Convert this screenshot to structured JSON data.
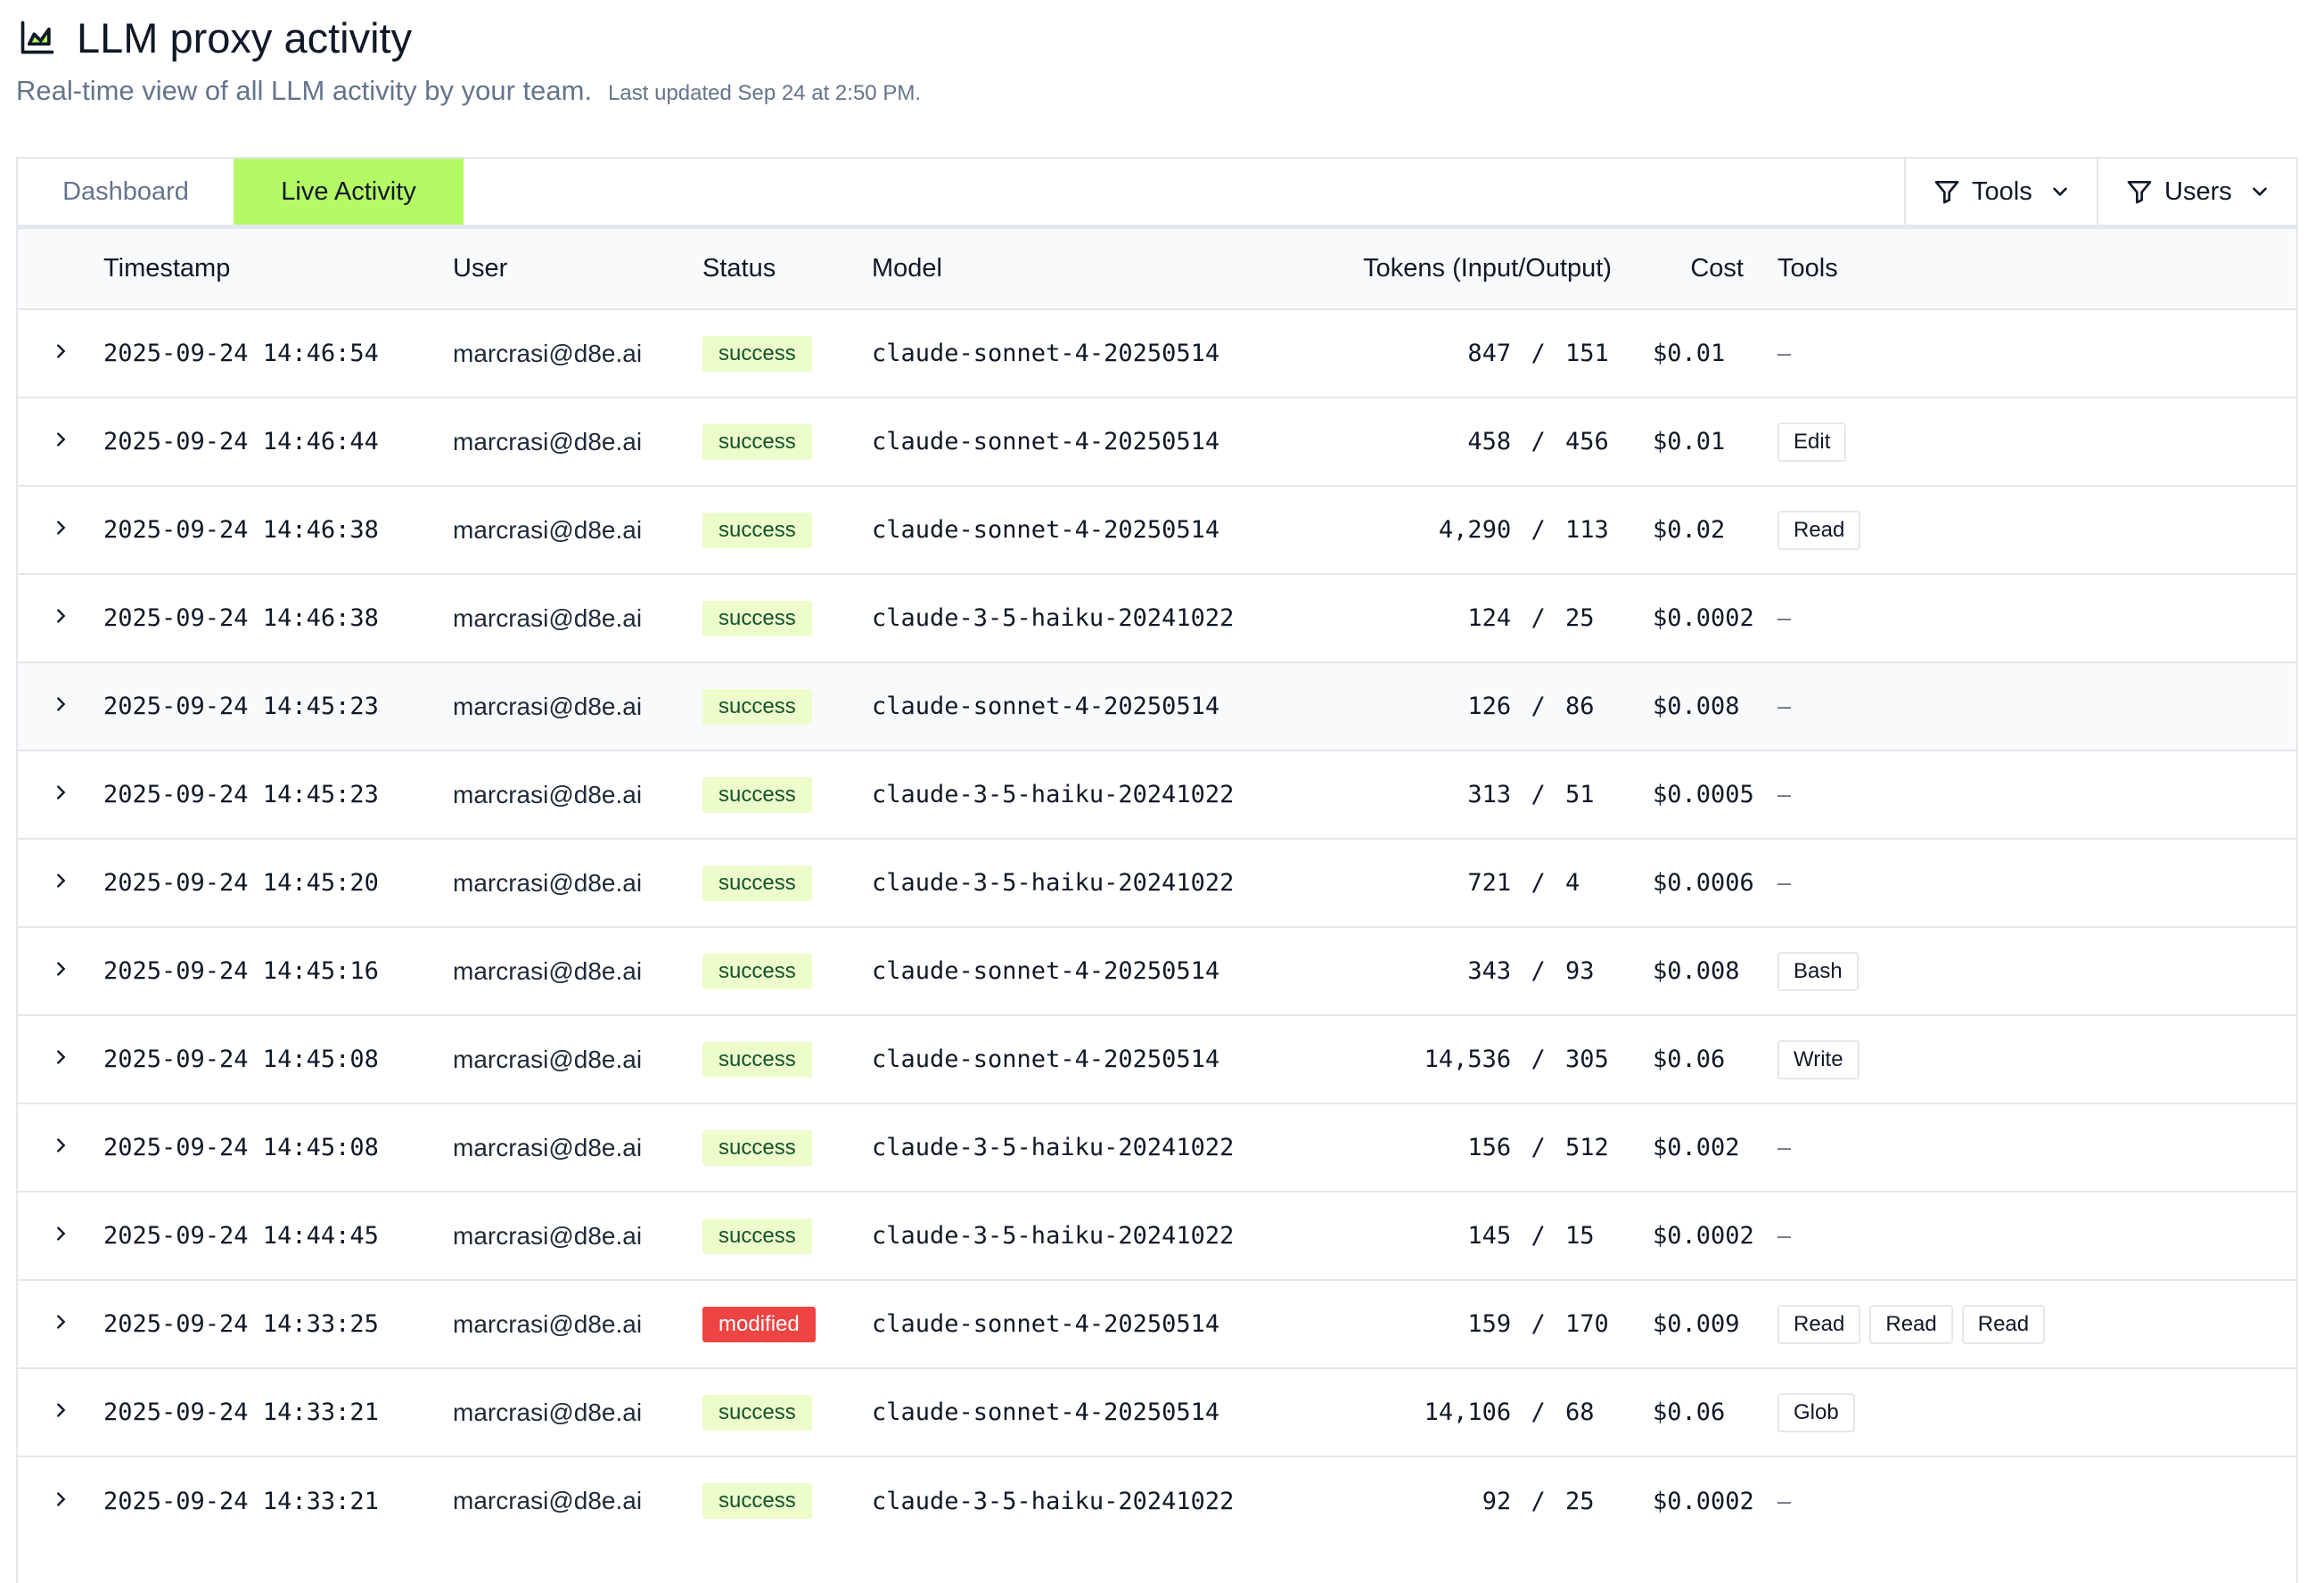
{
  "header": {
    "icon": "area-chart-icon",
    "title": "LLM proxy activity",
    "subtitle": "Real-time view of all LLM activity by your team.",
    "last_updated": "Last updated Sep 24 at 2:50 PM."
  },
  "tabs": [
    {
      "label": "Dashboard",
      "active": false
    },
    {
      "label": "Live Activity",
      "active": true
    }
  ],
  "filters": {
    "tools": "Tools",
    "users": "Users"
  },
  "columns": [
    "Timestamp",
    "User",
    "Status",
    "Model",
    "Tokens (Input/Output)",
    "Cost",
    "Tools"
  ],
  "rows": [
    {
      "timestamp": "2025-09-24 14:46:54",
      "user": "marcrasi@d8e.ai",
      "status": "success",
      "model": "claude-sonnet-4-20250514",
      "tokens_in": "847",
      "tokens_out": "151",
      "cost": "$0.01",
      "tools": []
    },
    {
      "timestamp": "2025-09-24 14:46:44",
      "user": "marcrasi@d8e.ai",
      "status": "success",
      "model": "claude-sonnet-4-20250514",
      "tokens_in": "458",
      "tokens_out": "456",
      "cost": "$0.01",
      "tools": [
        "Edit"
      ]
    },
    {
      "timestamp": "2025-09-24 14:46:38",
      "user": "marcrasi@d8e.ai",
      "status": "success",
      "model": "claude-sonnet-4-20250514",
      "tokens_in": "4,290",
      "tokens_out": "113",
      "cost": "$0.02",
      "tools": [
        "Read"
      ]
    },
    {
      "timestamp": "2025-09-24 14:46:38",
      "user": "marcrasi@d8e.ai",
      "status": "success",
      "model": "claude-3-5-haiku-20241022",
      "tokens_in": "124",
      "tokens_out": "25",
      "cost": "$0.0002",
      "tools": []
    },
    {
      "timestamp": "2025-09-24 14:45:23",
      "user": "marcrasi@d8e.ai",
      "status": "success",
      "model": "claude-sonnet-4-20250514",
      "tokens_in": "126",
      "tokens_out": "86",
      "cost": "$0.008",
      "tools": [],
      "highlight": true
    },
    {
      "timestamp": "2025-09-24 14:45:23",
      "user": "marcrasi@d8e.ai",
      "status": "success",
      "model": "claude-3-5-haiku-20241022",
      "tokens_in": "313",
      "tokens_out": "51",
      "cost": "$0.0005",
      "tools": []
    },
    {
      "timestamp": "2025-09-24 14:45:20",
      "user": "marcrasi@d8e.ai",
      "status": "success",
      "model": "claude-3-5-haiku-20241022",
      "tokens_in": "721",
      "tokens_out": "4",
      "cost": "$0.0006",
      "tools": []
    },
    {
      "timestamp": "2025-09-24 14:45:16",
      "user": "marcrasi@d8e.ai",
      "status": "success",
      "model": "claude-sonnet-4-20250514",
      "tokens_in": "343",
      "tokens_out": "93",
      "cost": "$0.008",
      "tools": [
        "Bash"
      ]
    },
    {
      "timestamp": "2025-09-24 14:45:08",
      "user": "marcrasi@d8e.ai",
      "status": "success",
      "model": "claude-sonnet-4-20250514",
      "tokens_in": "14,536",
      "tokens_out": "305",
      "cost": "$0.06",
      "tools": [
        "Write"
      ]
    },
    {
      "timestamp": "2025-09-24 14:45:08",
      "user": "marcrasi@d8e.ai",
      "status": "success",
      "model": "claude-3-5-haiku-20241022",
      "tokens_in": "156",
      "tokens_out": "512",
      "cost": "$0.002",
      "tools": []
    },
    {
      "timestamp": "2025-09-24 14:44:45",
      "user": "marcrasi@d8e.ai",
      "status": "success",
      "model": "claude-3-5-haiku-20241022",
      "tokens_in": "145",
      "tokens_out": "15",
      "cost": "$0.0002",
      "tools": []
    },
    {
      "timestamp": "2025-09-24 14:33:25",
      "user": "marcrasi@d8e.ai",
      "status": "modified",
      "model": "claude-sonnet-4-20250514",
      "tokens_in": "159",
      "tokens_out": "170",
      "cost": "$0.009",
      "tools": [
        "Read",
        "Read",
        "Read"
      ]
    },
    {
      "timestamp": "2025-09-24 14:33:21",
      "user": "marcrasi@d8e.ai",
      "status": "success",
      "model": "claude-sonnet-4-20250514",
      "tokens_in": "14,106",
      "tokens_out": "68",
      "cost": "$0.06",
      "tools": [
        "Glob"
      ]
    },
    {
      "timestamp": "2025-09-24 14:33:21",
      "user": "marcrasi@d8e.ai",
      "status": "success",
      "model": "claude-3-5-haiku-20241022",
      "tokens_in": "92",
      "tokens_out": "25",
      "cost": "$0.0002",
      "tools": []
    }
  ],
  "empty_tools": "–",
  "token_separator": "/",
  "colors": {
    "accent": "#b4fa64",
    "success_bg": "#ecfccb",
    "modified_bg": "#ef4444",
    "border": "#e5e7eb"
  }
}
